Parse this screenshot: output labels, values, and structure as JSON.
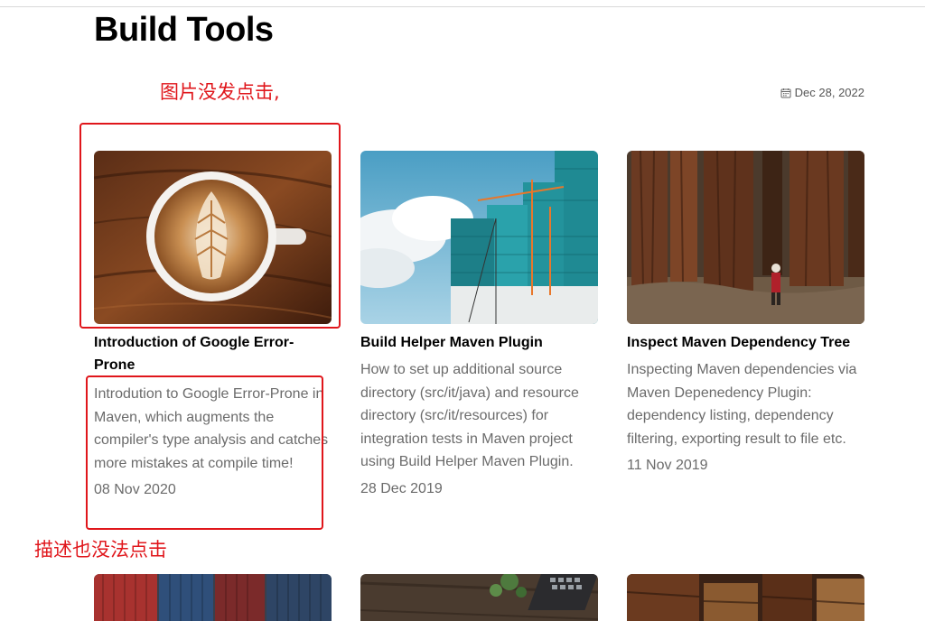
{
  "page": {
    "title": "Build Tools"
  },
  "meta": {
    "date": "Dec 28, 2022",
    "icon": "calendar-icon"
  },
  "annotations": {
    "image_note": "图片没发点击,",
    "desc_note": "描述也没法点击"
  },
  "colors": {
    "annotation": "#e0161b",
    "muted_text": "#6b6b6b",
    "title_text": "#000000"
  },
  "posts": [
    {
      "title": "Introduction of Google Error-Prone",
      "description": "Introdution to Google Error-Prone in Maven, which augments the compiler's type analysis and catches more mistakes at compile time!",
      "date": "08 Nov 2020",
      "image": "coffee-latte-art"
    },
    {
      "title": "Build Helper Maven Plugin",
      "description": "How to set up additional source directory (src/it/java) and resource directory (src/it/resources) for integration tests in Maven project using Build Helper Maven Plugin.",
      "date": "28 Dec 2019",
      "image": "buildings-under-construction"
    },
    {
      "title": "Inspect Maven Dependency Tree",
      "description": "Inspecting Maven dependencies via Maven Depenedency Plugin: dependency listing, dependency filtering, exporting result to file etc.",
      "date": "11 Nov 2019",
      "image": "redwood-forest"
    }
  ],
  "next_row_images": [
    "shipping-containers",
    "desk-with-keyboard-and-plant",
    "old-books"
  ]
}
